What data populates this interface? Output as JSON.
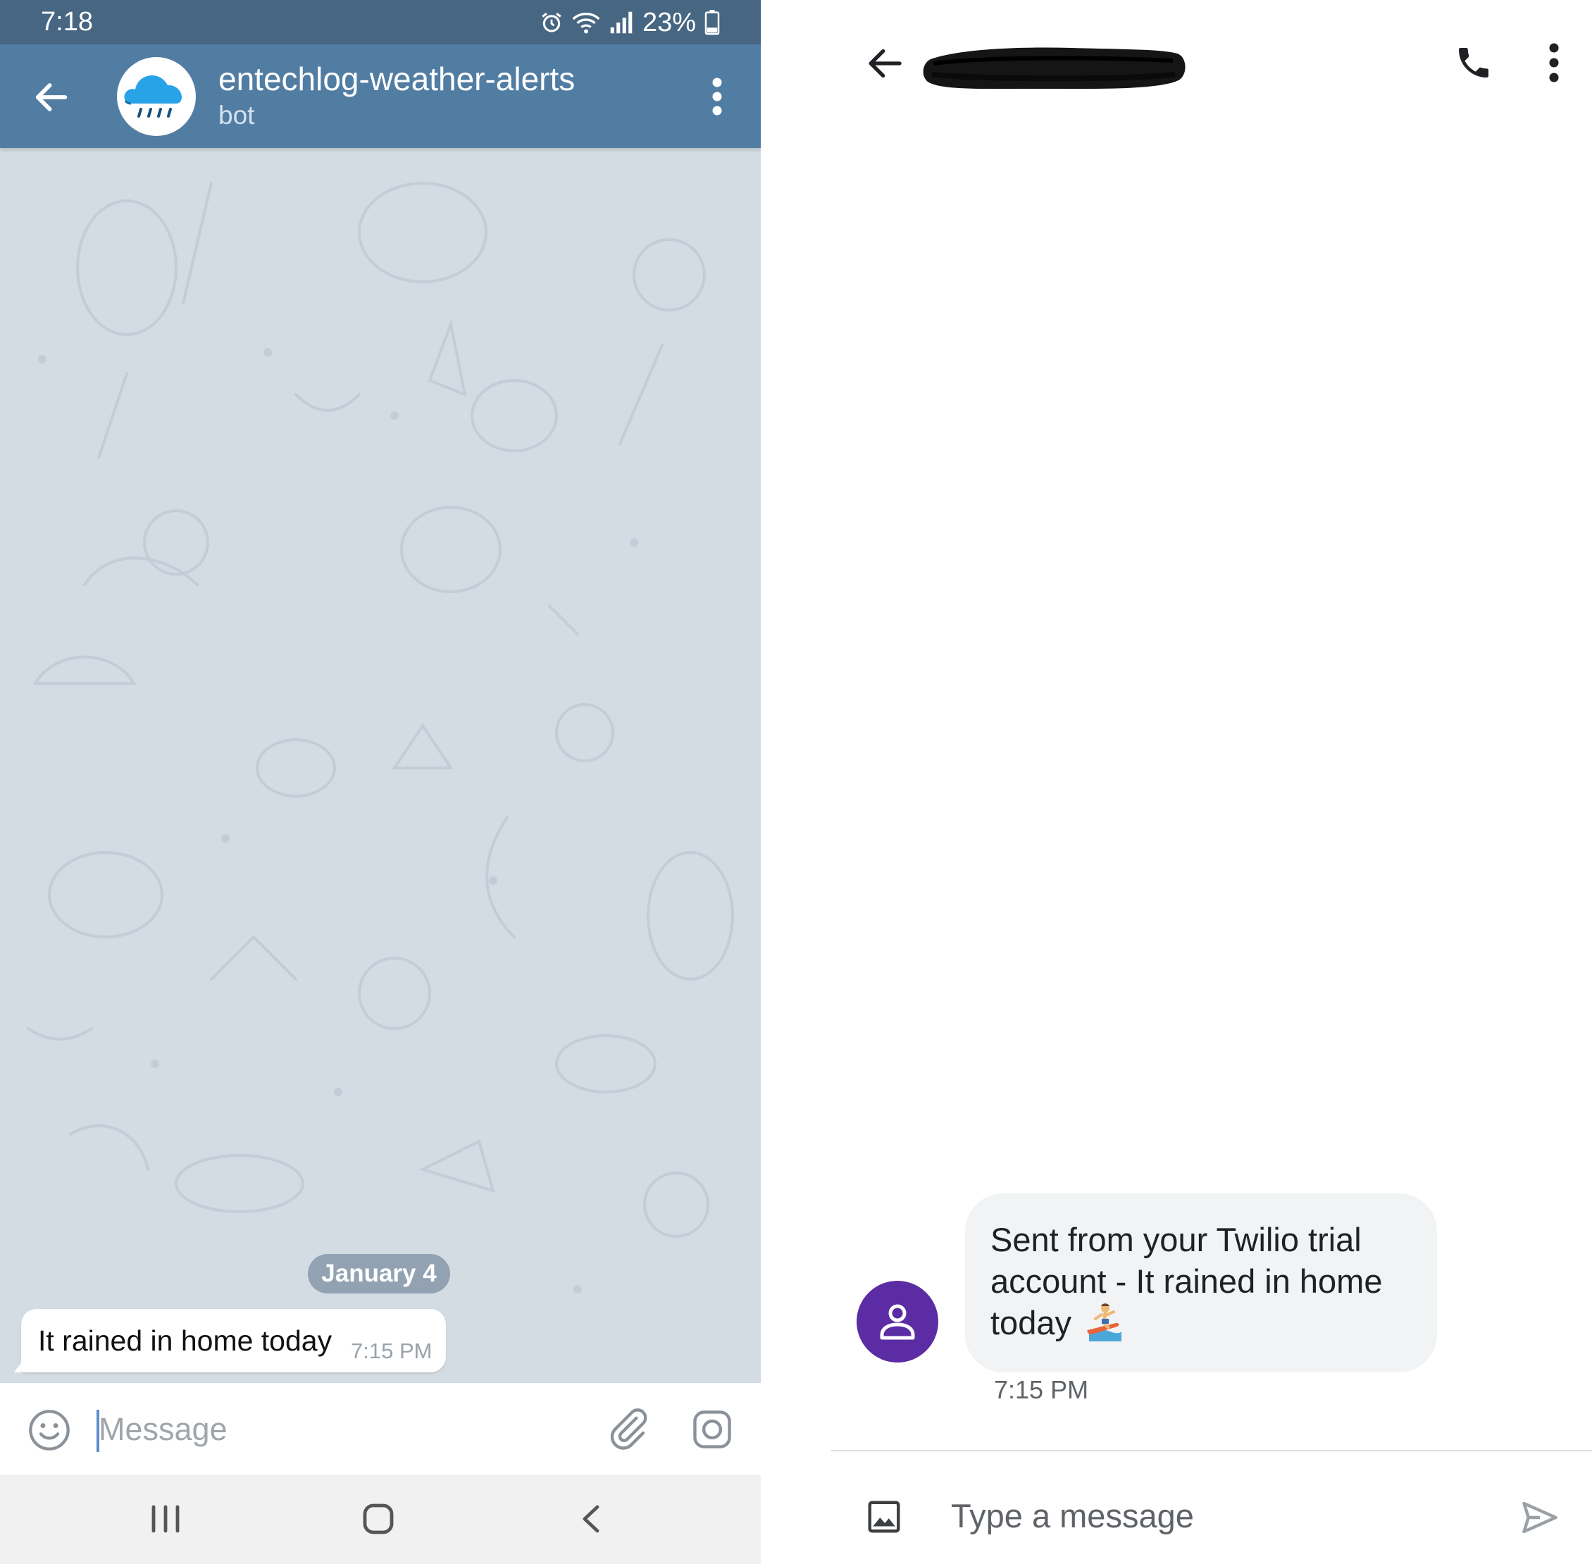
{
  "status_bar": {
    "time": "7:18",
    "battery": "23%"
  },
  "telegram": {
    "chat_title": "entechlog-weather-alerts",
    "chat_subtitle": "bot",
    "date_separator": "January 4",
    "message": {
      "text": "It rained in home today",
      "time": "7:15 PM"
    },
    "input_placeholder": "Message"
  },
  "sms": {
    "message": {
      "text": "Sent from your Twilio trial account - It rained in home today",
      "emoji_icon": "surfer-emoji",
      "time": "7:15 PM"
    },
    "input_placeholder": "Type a message",
    "colors": {
      "avatar": "#5b2ca3",
      "bubble": "#f1f3f4"
    }
  },
  "colors": {
    "telegram_header": "#527da3",
    "status_bar": "#466682",
    "wallpaper": "#d3dbe3"
  }
}
